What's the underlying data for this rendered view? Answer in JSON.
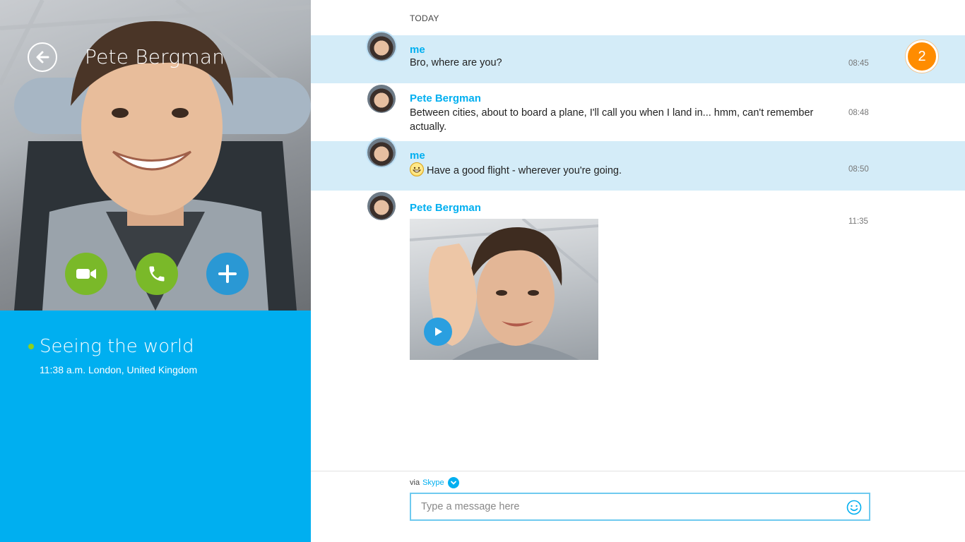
{
  "contact": {
    "name": "Pete Bergman",
    "mood": "Seeing the world",
    "location": "11:38 a.m. London, United Kingdom"
  },
  "actions": {
    "back_icon": "back-arrow-icon",
    "video_icon": "video-camera-icon",
    "call_icon": "phone-icon",
    "add_icon": "plus-icon"
  },
  "chat": {
    "day_label": "TODAY",
    "unread_count": "2",
    "messages": [
      {
        "sender": "me",
        "text": "Bro, where are you?",
        "time": "08:45"
      },
      {
        "sender": "Pete Bergman",
        "text": "Between cities, about to board a plane, I'll call you when I land in... hmm, can't remember actually.",
        "time": "08:48"
      },
      {
        "sender": "me",
        "text": "Have a good flight - wherever you're going.",
        "time": "08:50"
      },
      {
        "sender": "Pete Bergman",
        "text": "",
        "time": "11:35"
      }
    ]
  },
  "composer": {
    "via_label": "via",
    "via_service": "Skype",
    "placeholder": "Type a message here"
  },
  "colors": {
    "accent": "#00aff0",
    "my_message_bg": "#d4ecf8",
    "call_green": "#7ab929",
    "add_blue": "#2a98d4",
    "badge_orange": "#ff8c00",
    "presence_green": "#8ed11c"
  }
}
